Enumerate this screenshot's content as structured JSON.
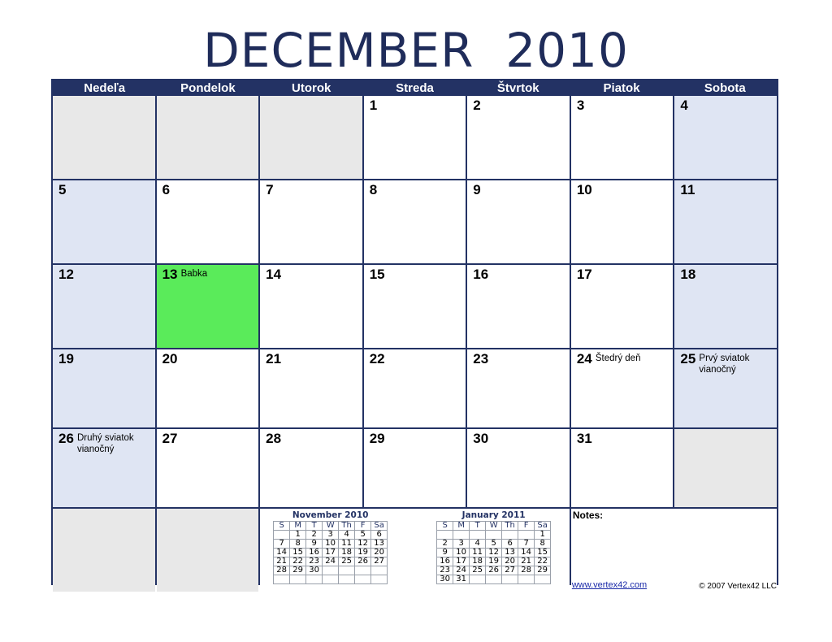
{
  "title": "DECEMBER  2010",
  "weekdays": [
    "Nedeľa",
    "Pondelok",
    "Utorok",
    "Streda",
    "Štvrtok",
    "Piatok",
    "Sobota"
  ],
  "weeks": [
    [
      {
        "day": "",
        "note": "",
        "type": "empty"
      },
      {
        "day": "",
        "note": "",
        "type": "empty"
      },
      {
        "day": "",
        "note": "",
        "type": "empty"
      },
      {
        "day": "1",
        "note": "",
        "type": "weekday"
      },
      {
        "day": "2",
        "note": "",
        "type": "weekday"
      },
      {
        "day": "3",
        "note": "",
        "type": "weekday"
      },
      {
        "day": "4",
        "note": "",
        "type": "weekend"
      }
    ],
    [
      {
        "day": "5",
        "note": "",
        "type": "weekend"
      },
      {
        "day": "6",
        "note": "",
        "type": "weekday"
      },
      {
        "day": "7",
        "note": "",
        "type": "weekday"
      },
      {
        "day": "8",
        "note": "",
        "type": "weekday"
      },
      {
        "day": "9",
        "note": "",
        "type": "weekday"
      },
      {
        "day": "10",
        "note": "",
        "type": "weekday"
      },
      {
        "day": "11",
        "note": "",
        "type": "weekend"
      }
    ],
    [
      {
        "day": "12",
        "note": "",
        "type": "weekend"
      },
      {
        "day": "13",
        "note": "Babka",
        "type": "highlight"
      },
      {
        "day": "14",
        "note": "",
        "type": "weekday"
      },
      {
        "day": "15",
        "note": "",
        "type": "weekday"
      },
      {
        "day": "16",
        "note": "",
        "type": "weekday"
      },
      {
        "day": "17",
        "note": "",
        "type": "weekday"
      },
      {
        "day": "18",
        "note": "",
        "type": "weekend"
      }
    ],
    [
      {
        "day": "19",
        "note": "",
        "type": "weekend"
      },
      {
        "day": "20",
        "note": "",
        "type": "weekday"
      },
      {
        "day": "21",
        "note": "",
        "type": "weekday"
      },
      {
        "day": "22",
        "note": "",
        "type": "weekday"
      },
      {
        "day": "23",
        "note": "",
        "type": "weekday"
      },
      {
        "day": "24",
        "note": "Štedrý deň",
        "type": "weekday"
      },
      {
        "day": "25",
        "note": "Prvý sviatok vianočný",
        "type": "weekend"
      }
    ],
    [
      {
        "day": "26",
        "note": "Druhý sviatok vianočný",
        "type": "weekend"
      },
      {
        "day": "27",
        "note": "",
        "type": "weekday"
      },
      {
        "day": "28",
        "note": "",
        "type": "weekday"
      },
      {
        "day": "29",
        "note": "",
        "type": "weekday"
      },
      {
        "day": "30",
        "note": "",
        "type": "weekday"
      },
      {
        "day": "31",
        "note": "",
        "type": "weekday"
      },
      {
        "day": "",
        "note": "",
        "type": "empty"
      }
    ]
  ],
  "mini_calendars": {
    "prev": {
      "title": "November 2010",
      "dow": [
        "S",
        "M",
        "T",
        "W",
        "Th",
        "F",
        "Sa"
      ],
      "rows": [
        [
          "",
          "1",
          "2",
          "3",
          "4",
          "5",
          "6"
        ],
        [
          "7",
          "8",
          "9",
          "10",
          "11",
          "12",
          "13"
        ],
        [
          "14",
          "15",
          "16",
          "17",
          "18",
          "19",
          "20"
        ],
        [
          "21",
          "22",
          "23",
          "24",
          "25",
          "26",
          "27"
        ],
        [
          "28",
          "29",
          "30",
          "",
          "",
          "",
          ""
        ],
        [
          "",
          "",
          "",
          "",
          "",
          "",
          ""
        ]
      ]
    },
    "next": {
      "title": "January 2011",
      "dow": [
        "S",
        "M",
        "T",
        "W",
        "Th",
        "F",
        "Sa"
      ],
      "rows": [
        [
          "",
          "",
          "",
          "",
          "",
          "",
          "1"
        ],
        [
          "2",
          "3",
          "4",
          "5",
          "6",
          "7",
          "8"
        ],
        [
          "9",
          "10",
          "11",
          "12",
          "13",
          "14",
          "15"
        ],
        [
          "16",
          "17",
          "18",
          "19",
          "20",
          "21",
          "22"
        ],
        [
          "23",
          "24",
          "25",
          "26",
          "27",
          "28",
          "29"
        ],
        [
          "30",
          "31",
          "",
          "",
          "",
          "",
          ""
        ]
      ]
    }
  },
  "notes": {
    "label": "Notes:",
    "link_text": "www.vertex42.com",
    "copyright": "© 2007 Vertex42 LLC"
  },
  "colors": {
    "header_bg": "#233264",
    "weekend_bg": "#dfe5f3",
    "empty_bg": "#e8e8e8",
    "highlight_bg": "#5aeb5a",
    "title_color": "#1f2c5a"
  }
}
